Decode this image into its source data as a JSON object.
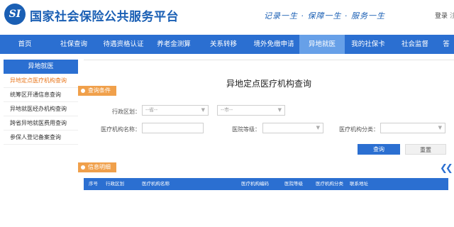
{
  "header": {
    "logo_text": "SI",
    "site_title": "国家社会保险公共服务平台",
    "slogan": "记录一生 · 保障一生 · 服务一生",
    "login_label": "登录",
    "login_extra": "注"
  },
  "nav": {
    "items": [
      {
        "label": "首页"
      },
      {
        "label": "社保查询"
      },
      {
        "label": "待遇资格认证"
      },
      {
        "label": "养老金测算"
      },
      {
        "label": "关系转移"
      },
      {
        "label": "境外免缴申请"
      },
      {
        "label": "异地就医"
      },
      {
        "label": "我的社保卡"
      },
      {
        "label": "社会监督"
      },
      {
        "label": "答"
      }
    ],
    "active": "异地就医"
  },
  "sidebar": {
    "heading": "异地就医",
    "items": [
      {
        "label": "异地定点医疗机构查询"
      },
      {
        "label": "统筹区开通信息查询"
      },
      {
        "label": "异地就医经办机构查询"
      },
      {
        "label": "跨省异地就医费用查询"
      },
      {
        "label": "参保人登记备案查询"
      }
    ],
    "active": "异地定点医疗机构查询"
  },
  "main": {
    "page_title": "异地定点医疗机构查询",
    "query_tag": "查询条件",
    "info_tag": "信息明细",
    "form": {
      "region_label": "行政区划：",
      "region_select1": "--省--",
      "region_select2": "--市--",
      "hospital_name_label": "医疗机构名称：",
      "hospital_name_value": "",
      "hospital_level_label": "医院等级：",
      "hospital_level_value": "",
      "hospital_category_label": "医疗机构分类：",
      "hospital_category_value": ""
    },
    "buttons": {
      "query": "查询",
      "reset": "重置"
    },
    "table": {
      "columns": [
        "序号",
        "行政区划",
        "医疗机构名称",
        "医疗机构编码",
        "医院等级",
        "医疗机构分类",
        "联系地址"
      ]
    }
  },
  "colors": {
    "brand_blue": "#2b6fd1",
    "nav_active": "#67a0e8",
    "accent_orange": "#f0a04b"
  }
}
